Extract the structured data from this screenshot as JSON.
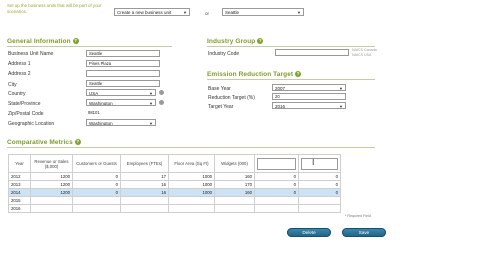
{
  "header": {
    "intro_text": "Set up the business units that will be part of your scenarios.",
    "business_unit_select": "Create a new business unit",
    "or_label": "or",
    "existing_unit_select": "Seattle"
  },
  "general_information": {
    "title": "General Information",
    "fields": [
      {
        "label": "Business Unit Name",
        "value": "Seattle"
      },
      {
        "label": "Address 1",
        "value": "Pines Plaza"
      },
      {
        "label": "Address 2",
        "value": ""
      },
      {
        "label": "City",
        "value": "Seattle"
      },
      {
        "label": "Country",
        "value": "USA"
      },
      {
        "label": "State/Province",
        "value": "Washington"
      },
      {
        "label": "Zip/Postal Code",
        "value": "98101"
      },
      {
        "label": "Geographic Location",
        "value": "Washington"
      }
    ]
  },
  "industry_group": {
    "title": "Industry Group",
    "industry_code_label": "Industry Code",
    "industry_code_value": "",
    "note_line1": "NAICS Canada",
    "note_line2": "NAICS USA"
  },
  "emission_target": {
    "title": "Emission Reduction Target",
    "base_year_label": "Base Year",
    "base_year_value": "2007",
    "reduction_label": "Reduction Target (%)",
    "reduction_value": "20",
    "target_year_label": "Target Year",
    "target_year_value": "2016"
  },
  "comparative_metrics": {
    "title": "Comparative Metrics",
    "columns": [
      "Year",
      "Revenue or Sales ($,000)",
      "Customers or Guests",
      "Employees (FTEs)",
      "Floor Area (Sq Ft)",
      "Widgets (000)",
      "",
      ""
    ],
    "rows": [
      [
        "2012",
        "1200",
        "0",
        "17",
        "1000",
        "160",
        "0",
        "0"
      ],
      [
        "2013",
        "1200",
        "0",
        "16",
        "1000",
        "170",
        "0",
        "0"
      ],
      [
        "2014",
        "1200",
        "0",
        "16",
        "1000",
        "160",
        "0",
        "0"
      ],
      [
        "2015",
        "",
        "",
        "",
        "",
        "",
        "",
        ""
      ],
      [
        "2016",
        "",
        "",
        "",
        "",
        "",
        "",
        ""
      ]
    ],
    "required_note": "* Required Field"
  },
  "buttons": {
    "delete_label": "Delete",
    "save_label": "Save"
  },
  "colors": {
    "section_title": "#7e9c2a",
    "button": "#1f5f86",
    "selected_row": "#cde3f4"
  }
}
